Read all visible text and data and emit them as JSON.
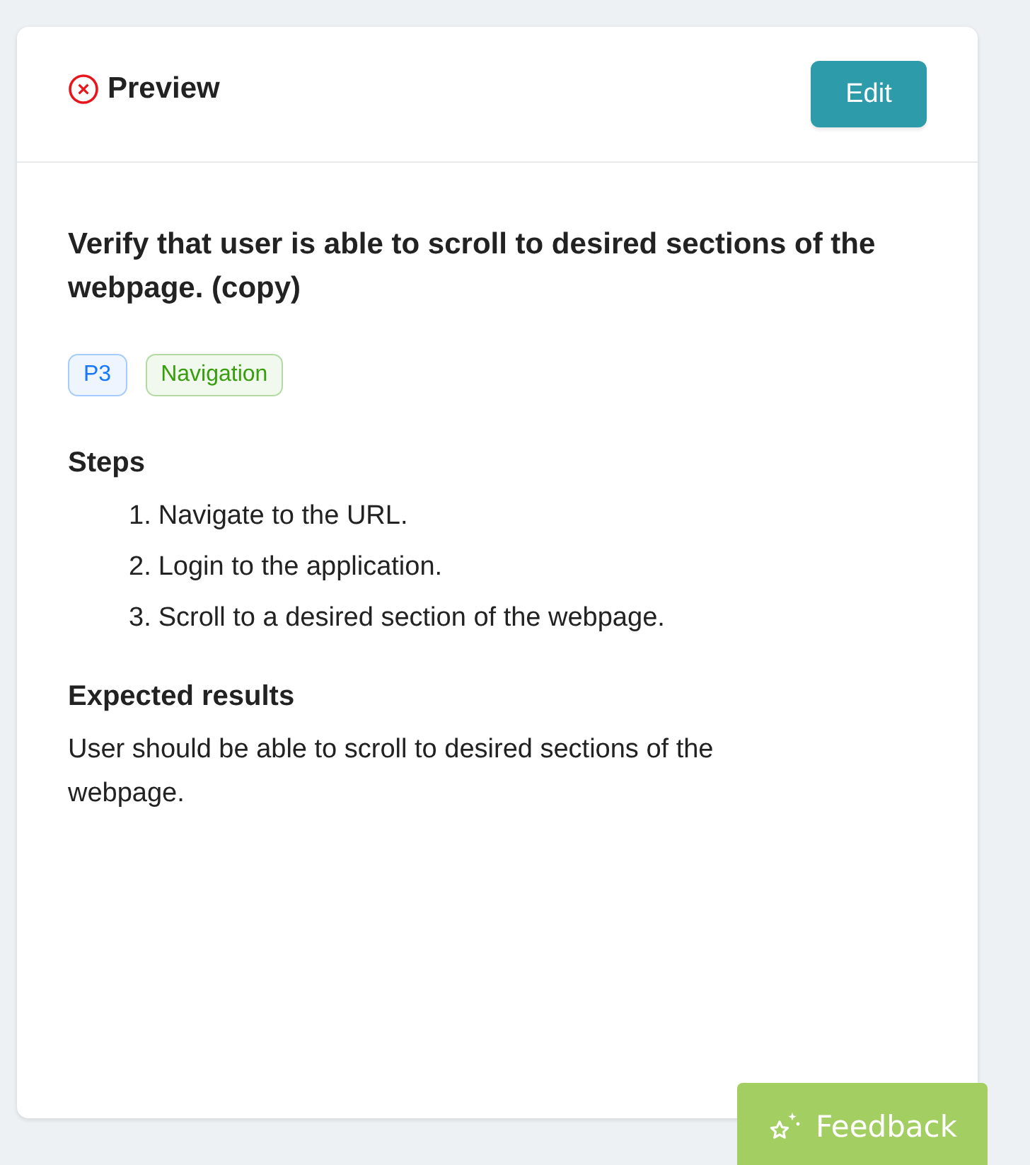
{
  "header": {
    "title": "Preview",
    "edit_button": "Edit"
  },
  "case": {
    "title": "Verify that user is able to scroll to desired sections of the webpage. (copy)",
    "tags": [
      {
        "label": "P3",
        "color": "#1677ff"
      },
      {
        "label": "Navigation",
        "color": "#389e0d"
      }
    ],
    "steps_heading": "Steps",
    "steps": [
      {
        "number": "1.",
        "text": "Navigate to the URL."
      },
      {
        "number": "2.",
        "text": "Login to the application."
      },
      {
        "number": "3.",
        "text": "Scroll to a desired section of the webpage."
      }
    ],
    "expected_heading": "Expected results",
    "expected": "User should be able to scroll to desired sections of the webpage."
  },
  "feedback_button": "Feedback"
}
